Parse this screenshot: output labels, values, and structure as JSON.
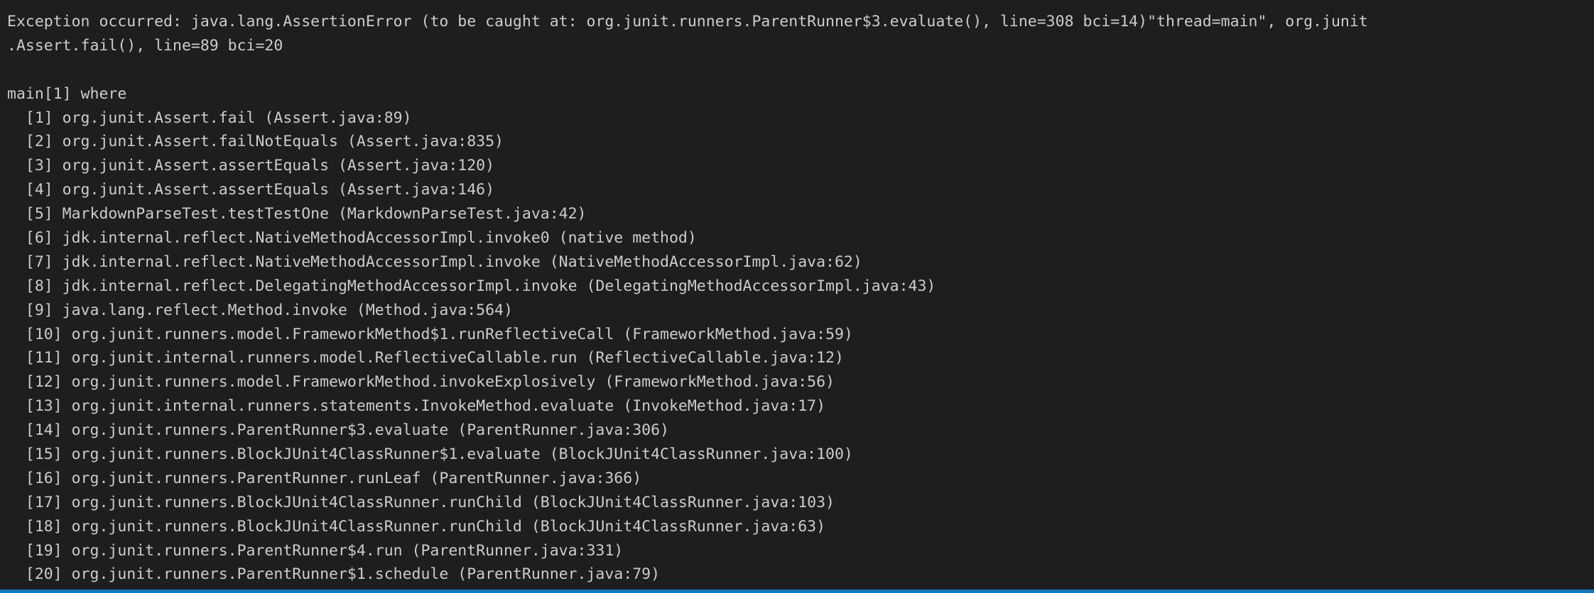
{
  "exception": {
    "line1": "Exception occurred: java.lang.AssertionError (to be caught at: org.junit.runners.ParentRunner$3.evaluate(), line=308 bci=14)\"thread=main\", org.junit",
    "line2": ".Assert.fail(), line=89 bci=20"
  },
  "prompt": {
    "command": "main[1] where"
  },
  "frames": [
    "  [1] org.junit.Assert.fail (Assert.java:89)",
    "  [2] org.junit.Assert.failNotEquals (Assert.java:835)",
    "  [3] org.junit.Assert.assertEquals (Assert.java:120)",
    "  [4] org.junit.Assert.assertEquals (Assert.java:146)",
    "  [5] MarkdownParseTest.testTestOne (MarkdownParseTest.java:42)",
    "  [6] jdk.internal.reflect.NativeMethodAccessorImpl.invoke0 (native method)",
    "  [7] jdk.internal.reflect.NativeMethodAccessorImpl.invoke (NativeMethodAccessorImpl.java:62)",
    "  [8] jdk.internal.reflect.DelegatingMethodAccessorImpl.invoke (DelegatingMethodAccessorImpl.java:43)",
    "  [9] java.lang.reflect.Method.invoke (Method.java:564)",
    "  [10] org.junit.runners.model.FrameworkMethod$1.runReflectiveCall (FrameworkMethod.java:59)",
    "  [11] org.junit.internal.runners.model.ReflectiveCallable.run (ReflectiveCallable.java:12)",
    "  [12] org.junit.runners.model.FrameworkMethod.invokeExplosively (FrameworkMethod.java:56)",
    "  [13] org.junit.internal.runners.statements.InvokeMethod.evaluate (InvokeMethod.java:17)",
    "  [14] org.junit.runners.ParentRunner$3.evaluate (ParentRunner.java:306)",
    "  [15] org.junit.runners.BlockJUnit4ClassRunner$1.evaluate (BlockJUnit4ClassRunner.java:100)",
    "  [16] org.junit.runners.ParentRunner.runLeaf (ParentRunner.java:366)",
    "  [17] org.junit.runners.BlockJUnit4ClassRunner.runChild (BlockJUnit4ClassRunner.java:103)",
    "  [18] org.junit.runners.BlockJUnit4ClassRunner.runChild (BlockJUnit4ClassRunner.java:63)",
    "  [19] org.junit.runners.ParentRunner$4.run (ParentRunner.java:331)",
    "  [20] org.junit.runners.ParentRunner$1.schedule (ParentRunner.java:79)"
  ],
  "colors": {
    "background": "#1e1e1e",
    "foreground": "#cccccc",
    "status_bar": "#007acc"
  }
}
